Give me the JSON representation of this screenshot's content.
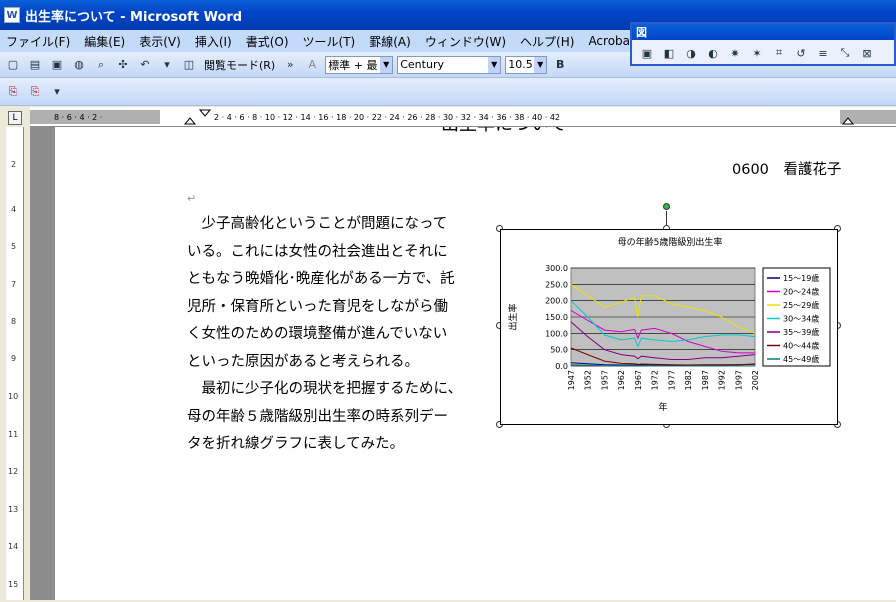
{
  "window": {
    "title": "出生率について - Microsoft Word",
    "app_icon": "W"
  },
  "menu": [
    "ファイル(F)",
    "編集(E)",
    "表示(V)",
    "挿入(I)",
    "書式(O)",
    "ツール(T)",
    "罫線(A)",
    "ウィンドウ(W)",
    "ヘルプ(H)",
    "Acrobat(B)"
  ],
  "toolbar": {
    "reading_mode": "閲覧モード(R)",
    "style": "標準 + 最",
    "font": "Century",
    "size": "10.5"
  },
  "picture_toolbar": {
    "title": "図"
  },
  "document": {
    "heading_partial": "出生率について",
    "author": "0600　看護花子",
    "lines": [
      "　少子高齢化ということが問題になって",
      "いる。これには女性の社会進出とそれに",
      "ともなう晩婚化･晩産化がある一方で、託",
      "児所・保育所といった育児をしながら働",
      "く女性のための環境整備が進んでいない",
      "といった原因があると考えられる。",
      "　最初に少子化の現状を把握するために、",
      "母の年齢５歳階級別出生率の時系列デー",
      "タを折れ線グラフに表してみた。"
    ]
  },
  "chart_data": {
    "type": "line",
    "title": "母の年齢5歳階級別出生率",
    "xlabel": "年",
    "ylabel": "出生率",
    "ylim": [
      0,
      300
    ],
    "yticks": [
      "300.0",
      "250.0",
      "200.0",
      "150.0",
      "100.0",
      "50.0",
      "0.0"
    ],
    "x_tick_labels": [
      "1947",
      "1952",
      "1957",
      "1962",
      "1967",
      "1972",
      "1977",
      "1982",
      "1987",
      "1992",
      "1997",
      "2002"
    ],
    "x": [
      1947,
      1952,
      1957,
      1962,
      1966,
      1967,
      1968,
      1972,
      1977,
      1982,
      1987,
      1992,
      1997,
      2002
    ],
    "series": [
      {
        "name": "15～19歳",
        "color": "#000080",
        "values": [
          10,
          7,
          4,
          3,
          3,
          3,
          3,
          4,
          3,
          3,
          4,
          4,
          4,
          6
        ]
      },
      {
        "name": "20～24歳",
        "color": "#cc00cc",
        "values": [
          170,
          140,
          110,
          105,
          112,
          85,
          110,
          115,
          100,
          75,
          60,
          45,
          40,
          40
        ]
      },
      {
        "name": "25～29歳",
        "color": "#e6e600",
        "values": [
          250,
          215,
          180,
          195,
          210,
          150,
          215,
          215,
          190,
          180,
          170,
          150,
          120,
          100
        ]
      },
      {
        "name": "30～34歳",
        "color": "#00cccc",
        "values": [
          200,
          150,
          95,
          80,
          85,
          60,
          85,
          80,
          75,
          80,
          90,
          95,
          95,
          90
        ]
      },
      {
        "name": "35～39歳",
        "color": "#800080",
        "values": [
          135,
          90,
          50,
          35,
          30,
          22,
          30,
          25,
          20,
          20,
          25,
          25,
          30,
          35
        ]
      },
      {
        "name": "40～44歳",
        "color": "#800000",
        "values": [
          55,
          35,
          15,
          8,
          7,
          5,
          6,
          5,
          4,
          3,
          3,
          3,
          4,
          5
        ]
      },
      {
        "name": "45～49歳",
        "color": "#008080",
        "values": [
          4,
          2,
          1,
          1,
          1,
          0,
          1,
          0,
          0,
          0,
          0,
          0,
          0,
          0
        ]
      }
    ]
  }
}
